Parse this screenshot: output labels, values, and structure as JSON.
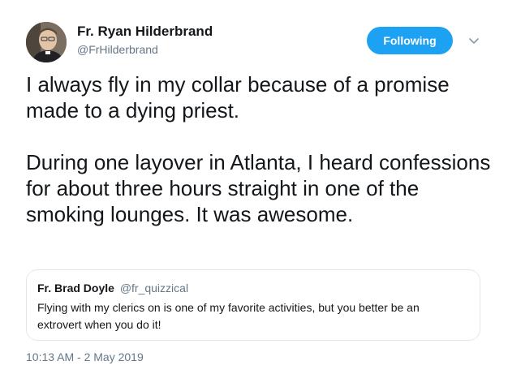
{
  "author": {
    "name": "Fr. Ryan Hilderbrand",
    "handle": "@FrHilderbrand"
  },
  "follow_button": {
    "label": "Following"
  },
  "more_menu_icon": "chevron-down-icon",
  "tweet": {
    "paragraphs": [
      "I always fly in my collar because of a promise made to a dying priest.",
      "During one layover in Atlanta, I heard confessions for about three hours straight in one of the smoking lounges. It was awesome."
    ],
    "timestamp": "10:13 AM - 2 May 2019"
  },
  "quoted_tweet": {
    "name": "Fr. Brad Doyle",
    "handle": "@fr_quizzical",
    "text": "Flying with my clerics on is one of my favorite activities, but you better be an extrovert when you do it!"
  },
  "colors": {
    "accent": "#1da1f2",
    "text_primary": "#14171a",
    "text_secondary": "#657786",
    "border": "#e1e8ed"
  }
}
